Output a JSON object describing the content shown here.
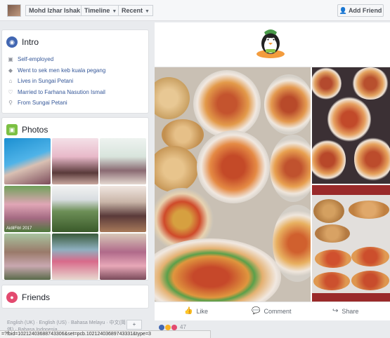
{
  "profile": {
    "name": "Mohd Izhar Ishak"
  },
  "topbar": {
    "timeline_label": "Timeline",
    "recent_label": "Recent",
    "add_friend_label": "Add Friend"
  },
  "intro": {
    "title": "Intro",
    "items": [
      {
        "icon": "briefcase-icon",
        "text": "Self-employed"
      },
      {
        "icon": "graduation-cap-icon",
        "text": "Went to sek men keb kuala pegang"
      },
      {
        "icon": "home-icon",
        "text": "Lives in Sungai Petani"
      },
      {
        "icon": "heart-icon",
        "text": "Married to Farhana Nasution Ismail"
      },
      {
        "icon": "location-pin-icon",
        "text": "From Sungai Petani"
      }
    ]
  },
  "photos": {
    "title": "Photos",
    "watermark": "AidilFitri 2017"
  },
  "friends": {
    "title": "Friends"
  },
  "footer": {
    "languages": "English (UK) · English (US) · Bahasa Melayu · 中文(简体) · Bahasa Indonesia",
    "more_label": "+"
  },
  "post": {
    "like_label": "Like",
    "comment_label": "Comment",
    "share_label": "Share",
    "reaction_count": "47"
  },
  "status_url": "=?fbid=10212403688743306&set=pcb.10212403689743331&type=3",
  "colors": {
    "link": "#365899",
    "intro_icon": "#4267b2",
    "photos_icon": "#7bc043",
    "friends_icon": "#e34a6f"
  }
}
